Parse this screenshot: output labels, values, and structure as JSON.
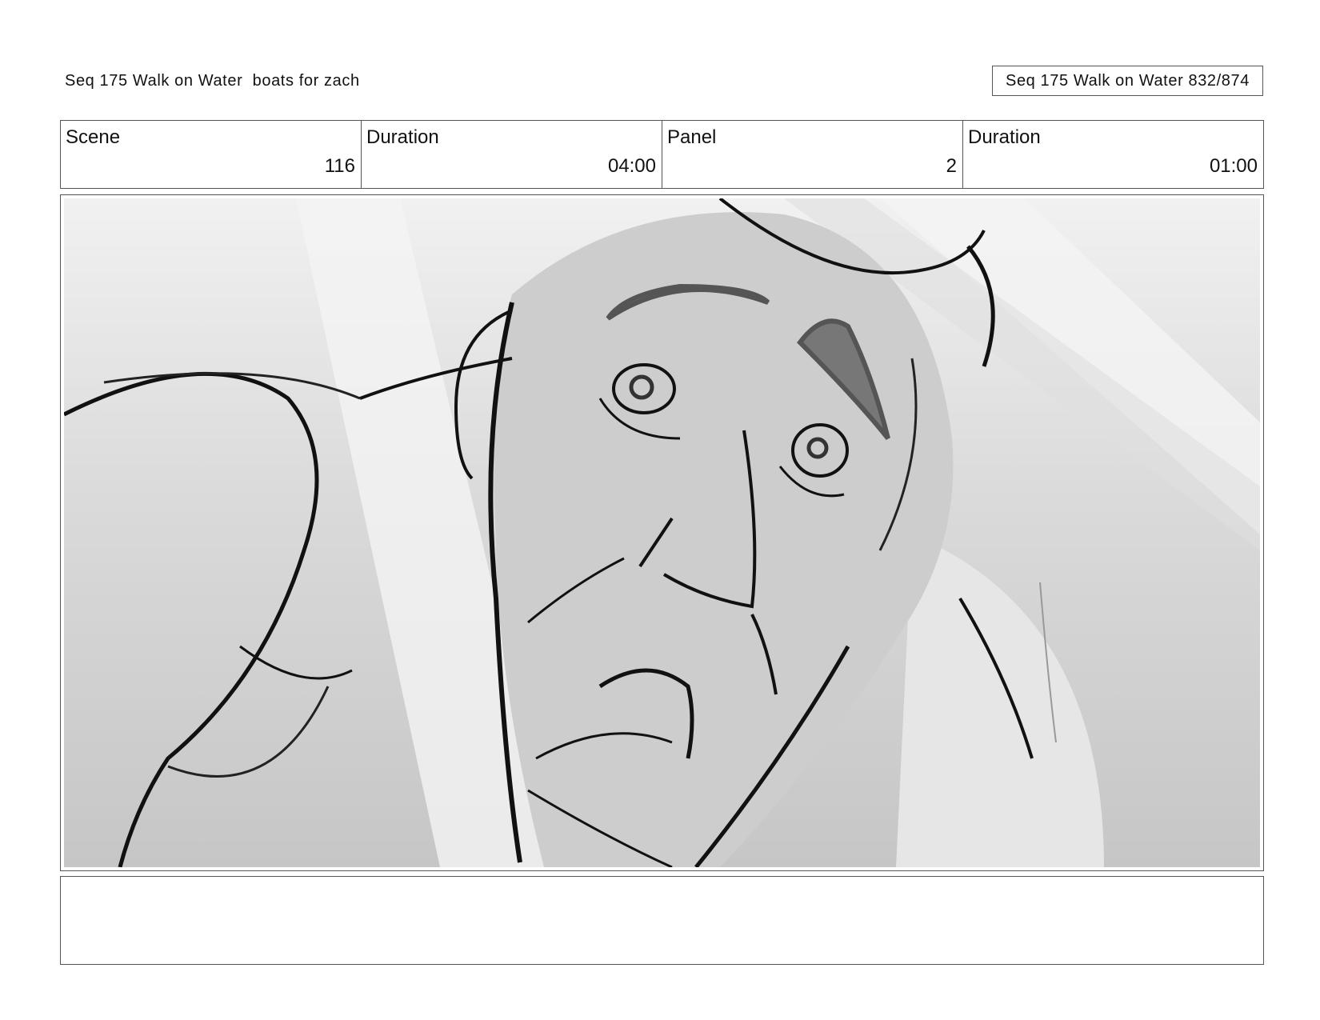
{
  "header": {
    "left_title": "Seq 175 Walk on Water  boats for zach",
    "right_title": "Seq 175 Walk on Water 832/874"
  },
  "info": [
    {
      "label": "Scene",
      "value": "116"
    },
    {
      "label": "Duration",
      "value": "04:00"
    },
    {
      "label": "Panel",
      "value": "2"
    },
    {
      "label": "Duration",
      "value": "01:00"
    }
  ],
  "panel_image": {
    "subject": "grayscale storyboard sketch, low-angle close-up of a startled man's face with light rays",
    "colors": {
      "background": "#cfcfcf",
      "light": "#eeeeee",
      "ink": "#111111"
    }
  },
  "notes": ""
}
